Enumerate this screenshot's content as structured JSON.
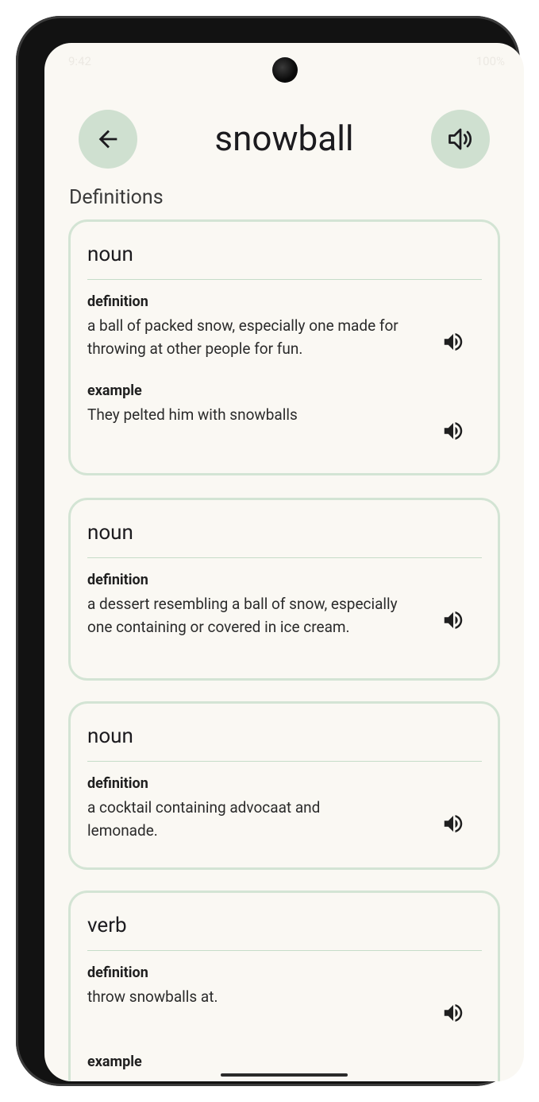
{
  "status_bar": {
    "time": "9:42",
    "battery": "100%"
  },
  "header": {
    "word": "snowball"
  },
  "section_label": "Definitions",
  "colors": {
    "accent": "#cfe0d0",
    "card_border": "#d3e4d4",
    "background": "#faf8f3"
  },
  "icons": {
    "back": "arrow-left-icon",
    "pronounce": "volume-icon",
    "speak": "speaker-icon"
  },
  "cards": [
    {
      "pos": "noun",
      "definition_label": "definition",
      "definition": "a ball of packed snow, especially one made for throwing at other people for fun.",
      "example_label": "example",
      "example": "They pelted him with snowballs"
    },
    {
      "pos": "noun",
      "definition_label": "definition",
      "definition": "a dessert resembling a ball of snow, especially one containing or covered in ice cream."
    },
    {
      "pos": "noun",
      "definition_label": "definition",
      "definition": "a cocktail containing advocaat and lemonade."
    },
    {
      "pos": "verb",
      "definition_label": "definition",
      "definition": "throw snowballs at.",
      "example_label": "example"
    }
  ]
}
